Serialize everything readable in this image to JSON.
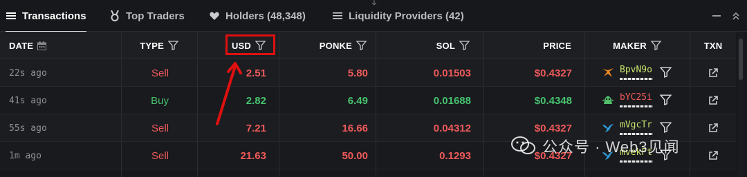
{
  "tabs": [
    {
      "label": "Transactions",
      "icon": "list-icon",
      "active": true
    },
    {
      "label": "Top Traders",
      "icon": "medal-icon",
      "active": false
    },
    {
      "label": "Holders (48,348)",
      "icon": "heart-icon",
      "active": false
    },
    {
      "label": "Liquidity Providers (42)",
      "icon": "lines-icon",
      "active": false
    }
  ],
  "columns": {
    "date": "DATE",
    "type": "TYPE",
    "usd": "USD",
    "ponke": "PONKE",
    "sol": "SOL",
    "price": "PRICE",
    "maker": "MAKER",
    "txn": "TXN"
  },
  "rows": [
    {
      "date": "22s ago",
      "type": "Sell",
      "usd": "2.51",
      "ponke": "5.80",
      "sol": "0.01503",
      "price": "$0.4327",
      "maker": "BpvN9o",
      "maker_color": "#c7e36b",
      "avatar": "orange-fox-icon"
    },
    {
      "date": "41s ago",
      "type": "Buy",
      "usd": "2.82",
      "ponke": "6.49",
      "sol": "0.01688",
      "price": "$0.4348",
      "maker": "bYC25i",
      "maker_color": "#ef5a5a",
      "avatar": "green-frog-icon"
    },
    {
      "date": "55s ago",
      "type": "Sell",
      "usd": "7.21",
      "ponke": "16.66",
      "sol": "0.04312",
      "price": "$0.4327",
      "maker": "mVgcTr",
      "maker_color": "#c7e36b",
      "avatar": "blue-bird-icon"
    },
    {
      "date": "1m ago",
      "type": "Sell",
      "usd": "21.63",
      "ponke": "50.00",
      "sol": "0.1293",
      "price": "$0.4327",
      "maker": "mvekFt",
      "maker_color": "#c7e36b",
      "avatar": "blue-bird-icon"
    }
  ],
  "watermark": "公众号 · Web3见闻",
  "colors": {
    "sell": "#ef5a5a",
    "buy": "#46c26f",
    "highlight": "#e01010"
  }
}
